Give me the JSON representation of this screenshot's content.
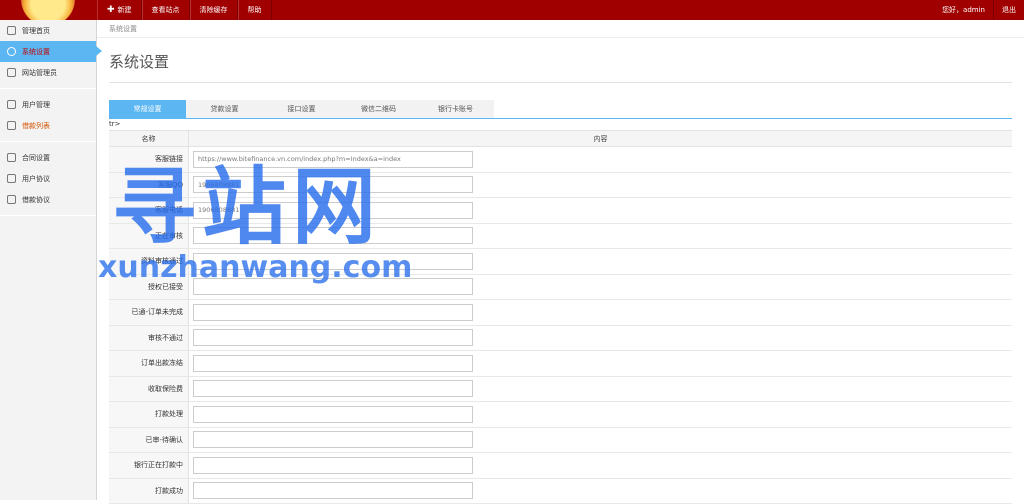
{
  "topbar": {
    "nav": [
      {
        "label": "新建",
        "icon": "plus-icon"
      },
      {
        "label": "查看站点"
      },
      {
        "label": "清除缓存"
      },
      {
        "label": "帮助"
      }
    ],
    "greeting": "您好，admin",
    "logout": "退出"
  },
  "sidebar": {
    "items": [
      {
        "label": "管理首页",
        "icon": "home-icon"
      },
      {
        "label": "系统设置",
        "icon": "gear-icon"
      },
      {
        "label": "网站管理员",
        "icon": "user-icon"
      },
      {
        "label": "用户管理",
        "icon": "users-icon"
      },
      {
        "label": "借款列表",
        "icon": "list-icon"
      },
      {
        "label": "合同设置",
        "icon": "contract-icon"
      },
      {
        "label": "用户协议",
        "icon": "document-icon"
      },
      {
        "label": "借款协议",
        "icon": "document-icon"
      }
    ]
  },
  "breadcrumb": "系统设置",
  "page_title": "系统设置",
  "tabs": [
    "常规设置",
    "贷款设置",
    "接口设置",
    "微信二维码",
    "银行卡账号"
  ],
  "stray_text": "tr>",
  "table": {
    "headers": [
      "名称",
      "内容"
    ],
    "rows": [
      {
        "label": "客服链接",
        "value": "https://www.bitefinance.vn.com/index.php?m=Index&a=index"
      },
      {
        "label": "客服QQ",
        "value": "1906808881"
      },
      {
        "label": "客服电话",
        "value": "1906808881"
      },
      {
        "label": "正在审核",
        "value": ""
      },
      {
        "label": "资料审核通过",
        "value": ""
      },
      {
        "label": "授权已接受",
        "value": ""
      },
      {
        "label": "已通-订单未完成",
        "value": ""
      },
      {
        "label": "审核不通过",
        "value": ""
      },
      {
        "label": "订单出款冻结",
        "value": ""
      },
      {
        "label": "收取保险费",
        "value": ""
      },
      {
        "label": "打款处理",
        "value": ""
      },
      {
        "label": "已审-待确认",
        "value": ""
      },
      {
        "label": "银行正在打款中",
        "value": ""
      },
      {
        "label": "打款成功",
        "value": ""
      }
    ]
  },
  "watermark": {
    "cn": "寻站网",
    "en": "xunzhanwang.com"
  },
  "colors": {
    "topbar": "#a00000",
    "accent": "#5bb6f2",
    "active_text": "#c40000"
  }
}
